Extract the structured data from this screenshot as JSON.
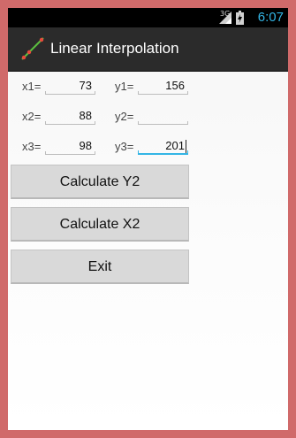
{
  "status_bar": {
    "network": "3G",
    "time": "6:07"
  },
  "action_bar": {
    "title": "Linear Interpolation",
    "icon": "line-graph-icon"
  },
  "form": {
    "x1": {
      "label": "x1=",
      "value": "73"
    },
    "y1": {
      "label": "y1=",
      "value": "156"
    },
    "x2": {
      "label": "x2=",
      "value": "88"
    },
    "y2": {
      "label": "y2=",
      "value": ""
    },
    "x3": {
      "label": "x3=",
      "value": "98"
    },
    "y3": {
      "label": "y3=",
      "value": "201"
    }
  },
  "buttons": {
    "calc_y2": "Calculate Y2",
    "calc_x2": "Calculate X2",
    "exit": "Exit"
  },
  "colors": {
    "accent": "#33b5e5",
    "action_bar": "#2b2b2b",
    "frame": "#d06a6a"
  }
}
